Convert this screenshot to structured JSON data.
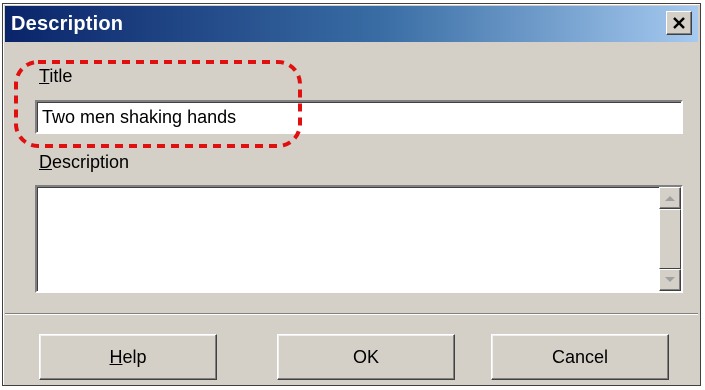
{
  "dialog": {
    "title": "Description"
  },
  "close_button": {
    "icon": "close-icon"
  },
  "title_field": {
    "label_mnemonic": "T",
    "label_rest": "itle",
    "value": "Two men shaking hands"
  },
  "description_field": {
    "label_mnemonic": "D",
    "label_rest": "escription",
    "value": ""
  },
  "buttons": {
    "help_mnemonic": "H",
    "help_rest": "elp",
    "ok": "OK",
    "cancel": "Cancel"
  },
  "annotation": {
    "color": "#e01010",
    "style": "dashed-rounded-rectangle"
  }
}
